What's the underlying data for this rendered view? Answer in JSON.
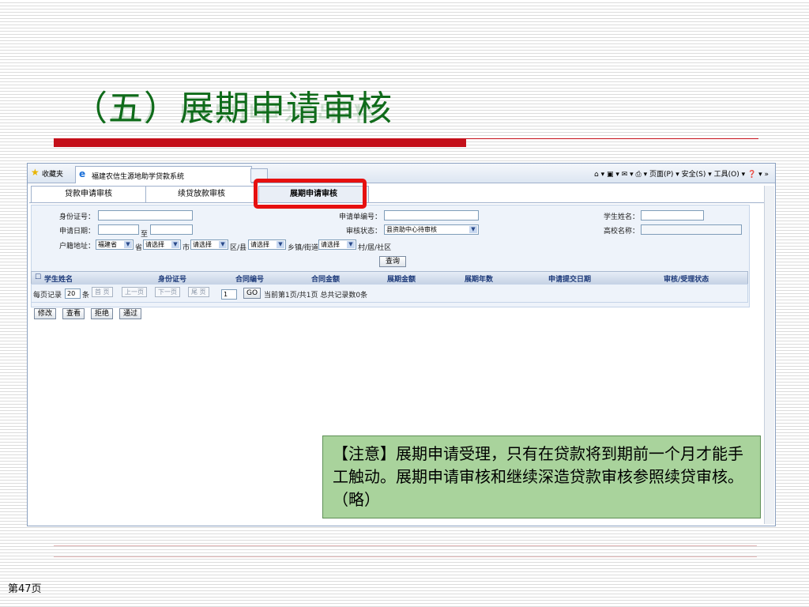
{
  "slide": {
    "title": "（五）展期申请审核",
    "page_number": "第47页",
    "note": "【注意】展期申请受理，只有在贷款将到期前一个月才能手工触动。展期申请审核和继续深造贷款审核参照续贷审核。（略）"
  },
  "browser": {
    "favorites_label": "收藏夹",
    "tab_title": "福建农信生源地助学贷款系统",
    "toolbar_right": "页面(P) ▾  安全(S) ▾  工具(O) ▾",
    "overflow": "»"
  },
  "app": {
    "tabs": [
      "贷款申请审核",
      "续贷放款审核",
      "展期申请审核"
    ],
    "form": {
      "id_label": "身份证号：",
      "apply_no_label": "申请单编号：",
      "student_label": "学生姓名：",
      "date_label": "申请日期：",
      "date_to": "至",
      "status_label": "审核状态：",
      "status_value": "县资助中心待审核",
      "school_label": "高校名称：",
      "addr_label": "户籍地址：",
      "province_value": "福建省",
      "province_suffix": "省",
      "city_value": "请选择",
      "city_suffix": "市",
      "district_value": "请选择",
      "district_suffix": "区/县",
      "town_value": "请选择",
      "town_suffix": "乡镇/街道",
      "village_value": "请选择",
      "village_suffix": "村/居/社区",
      "query_button": "查询"
    },
    "grid": {
      "columns": [
        "学生姓名",
        "身份证号",
        "合同编号",
        "合同金额",
        "展期金额",
        "展期年数",
        "申请提交日期",
        "审核/受理状态"
      ]
    },
    "pager": {
      "per_page_label": "每页记录",
      "per_page_value": "20",
      "per_page_unit": "条",
      "first": "首 页",
      "prev": "上一页",
      "next": "下一页",
      "last": "尾 页",
      "page_value": "1",
      "go": "GO",
      "summary": "当前第1页/共1页 总共记录数0条"
    },
    "actions": [
      "修改",
      "查看",
      "拒绝",
      "通过"
    ]
  }
}
